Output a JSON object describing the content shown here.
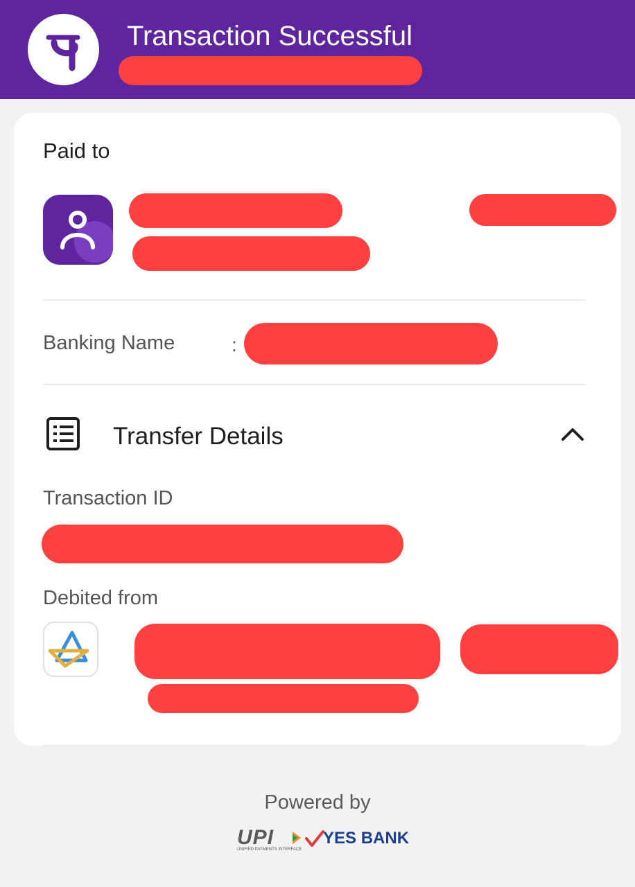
{
  "header": {
    "title": "Transaction Successful",
    "logo_icon": "phonepe-logo-icon",
    "background_color": "#5f259f"
  },
  "paid_to": {
    "label": "Paid to",
    "avatar_icon": "user-avatar-icon"
  },
  "banking_name": {
    "label": "Banking Name",
    "separator": ":"
  },
  "transfer_details": {
    "title": "Transfer Details",
    "icon": "receipt-list-icon",
    "toggle_icon": "chevron-up-icon",
    "transaction_id_label": "Transaction ID",
    "debited_from_label": "Debited from",
    "bank_logo_icon": "yes-bank-logo-icon"
  },
  "footer": {
    "powered_by": "Powered by",
    "upi_logo_text": "UPI",
    "upi_subtext": "UNIFIED PAYMENTS INTERFACE",
    "bank_name": "YES BANK"
  },
  "colors": {
    "accent": "#5f259f",
    "redaction": "#ff4040",
    "yes_bank_blue": "#1b3f8f"
  }
}
